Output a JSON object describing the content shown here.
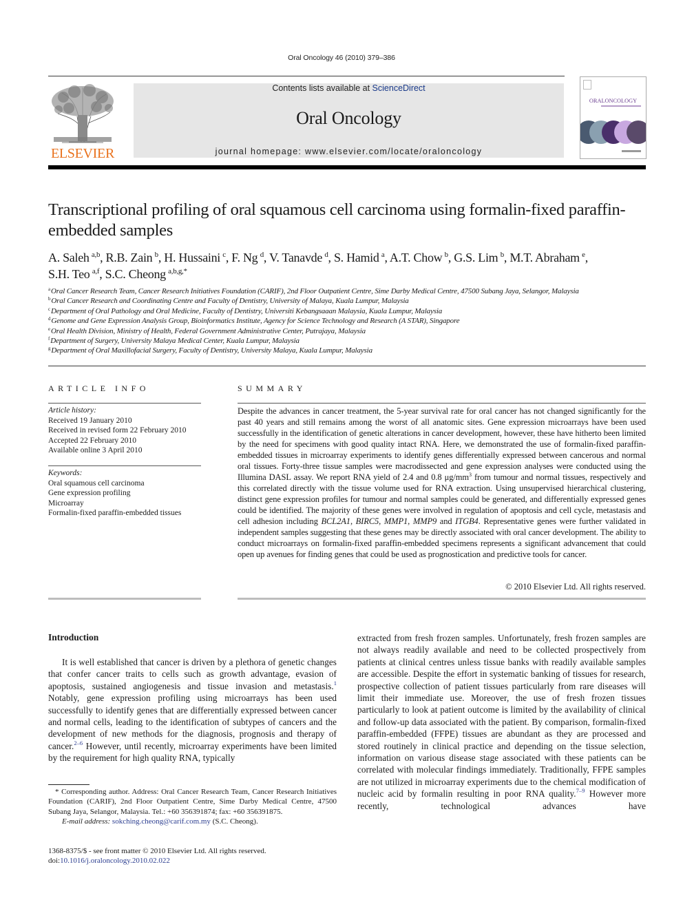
{
  "header": {
    "citation": "Oral Oncology 46 (2010) 379–386",
    "publisher_logo_text": "ELSEVIER",
    "contents_prefix": "Contents lists available at ",
    "contents_link": "ScienceDirect",
    "journal_title": "Oral Oncology",
    "homepage": "journal homepage: www.elsevier.com/locate/oraloncology",
    "cover_title": "ORALONCOLOGY"
  },
  "colors": {
    "publisher_orange": "#e9711c",
    "link_blue": "#2a3c8f",
    "masthead_gray": "#e6e6e6",
    "cover_purple": "#6a3d8f"
  },
  "article": {
    "title": "Transcriptional profiling of oral squamous cell carcinoma using formalin-fixed paraffin-embedded samples",
    "authors": [
      {
        "name": "A. Saleh",
        "sup": "a,b"
      },
      {
        "name": "R.B. Zain",
        "sup": "b"
      },
      {
        "name": "H. Hussaini",
        "sup": "c"
      },
      {
        "name": "F. Ng",
        "sup": "d"
      },
      {
        "name": "V. Tanavde",
        "sup": "d"
      },
      {
        "name": "S. Hamid",
        "sup": "a"
      },
      {
        "name": "A.T. Chow",
        "sup": "b"
      },
      {
        "name": "G.S. Lim",
        "sup": "b"
      },
      {
        "name": "M.T. Abraham",
        "sup": "e"
      },
      {
        "name": "S.H. Teo",
        "sup": "a,f"
      },
      {
        "name": "S.C. Cheong",
        "sup": "a,b,g,*"
      }
    ],
    "affiliations": [
      {
        "key": "a",
        "text": "Oral Cancer Research Team, Cancer Research Initiatives Foundation (CARIF), 2nd Floor Outpatient Centre, Sime Darby Medical Centre, 47500 Subang Jaya, Selangor, Malaysia"
      },
      {
        "key": "b",
        "text": "Oral Cancer Research and Coordinating Centre and Faculty of Dentistry, University of Malaya, Kuala Lumpur, Malaysia"
      },
      {
        "key": "c",
        "text": "Department of Oral Pathology and Oral Medicine, Faculty of Dentistry, Universiti Kebangsaaan Malaysia, Kuala Lumpur, Malaysia"
      },
      {
        "key": "d",
        "text": "Genome and Gene Expression Analysis Group, Bioinformatics Institute, Agency for Science Technology and Research (A STAR), Singapore"
      },
      {
        "key": "e",
        "text": "Oral Health Division, Ministry of Health, Federal Government Administrative Center, Putrajaya, Malaysia"
      },
      {
        "key": "f",
        "text": "Department of Surgery, University Malaya Medical Center, Kuala Lumpur, Malaysia"
      },
      {
        "key": "g",
        "text": "Department of Oral Maxillofacial Surgery, Faculty of Dentistry, University Malaya, Kuala Lumpur, Malaysia"
      }
    ]
  },
  "article_info": {
    "heading": "ARTICLE INFO",
    "history_label": "Article history:",
    "history": [
      "Received 19 January 2010",
      "Received in revised form 22 February 2010",
      "Accepted 22 February 2010",
      "Available online 3 April 2010"
    ],
    "keywords_label": "Keywords:",
    "keywords": [
      "Oral squamous cell carcinoma",
      "Gene expression profiling",
      "Microarray",
      "Formalin-fixed paraffin-embedded tissues"
    ]
  },
  "summary": {
    "heading": "SUMMARY",
    "part1": "Despite the advances in cancer treatment, the 5-year survival rate for oral cancer has not changed significantly for the past 40 years and still remains among the worst of all anatomic sites. Gene expression microarrays have been used successfully in the identification of genetic alterations in cancer development, however, these have hitherto been limited by the need for specimens with good quality intact RNA. Here, we demonstrated the use of formalin-fixed paraffin-embedded tissues in microarray experiments to identify genes differentially expressed between cancerous and normal oral tissues. Forty-three tissue samples were macrodissected and gene expression analyses were conducted using the Illumina DASL assay. We report RNA yield of 2.4 and 0.8 μg/mm",
    "sup1": "3",
    "part2": " from tumour and normal tissues, respectively and this correlated directly with the tissue volume used for RNA extraction. Using unsupervised hierarchical clustering, distinct gene expression profiles for tumour and normal samples could be generated, and differentially expressed genes could be identified. The majority of these genes were involved in regulation of apoptosis and cell cycle, metastasis and cell adhesion including ",
    "genes": [
      "BCL2A1",
      "BIRC5",
      "MMP1",
      "MMP9",
      "ITGB4"
    ],
    "sep1": ", ",
    "sep_and": " and ",
    "part3": ". Representative genes were further validated in independent samples suggesting that these genes may be directly associated with oral cancer development. The ability to conduct microarrays on formalin-fixed paraffin-embedded specimens represents a significant advancement that could open up avenues for finding genes that could be used as prognostication and predictive tools for cancer.",
    "copyright": "© 2010 Elsevier Ltd. All rights reserved."
  },
  "body": {
    "intro_heading": "Introduction",
    "left_p1_a": "It is well established that cancer is driven by a plethora of genetic changes that confer cancer traits to cells such as growth advantage, evasion of apoptosis, sustained angiogenesis and tissue invasion and metastasis.",
    "left_ref1": "1",
    "left_p1_b": " Notably, gene expression profiling using microarrays has been used successfully to identify genes that are differentially expressed between cancer and normal cells, leading to the identification of subtypes of cancers and the development of new methods for the diagnosis, prognosis and therapy of cancer.",
    "left_ref2": "2–6",
    "left_p1_c": " However, until recently, microarray experiments have been limited by the requirement for high quality RNA, typically",
    "right_a": "extracted from fresh frozen samples. Unfortunately, fresh frozen samples are not always readily available and need to be collected prospectively from patients at clinical centres unless tissue banks with readily available samples are accessible. Despite the effort in systematic banking of tissues for research, prospective collection of patient tissues particularly from rare diseases will limit their immediate use. Moreover, the use of fresh frozen tissues particularly to look at patient outcome is limited by the availability of clinical and follow-up data associated with the patient. By comparison, formalin-fixed paraffin-embedded (FFPE) tissues are abundant as they are processed and stored routinely in clinical practice and depending on the tissue selection, information on various disease stage associated with these patients can be correlated with molecular findings immediately. Traditionally, FFPE samples are not utilized in microarray experiments due to the chemical modification of nucleic acid by formalin resulting in poor RNA quality.",
    "right_ref": "7–9",
    "right_b": " However more recently, technological advances have"
  },
  "footnote": {
    "corresponding": "* Corresponding author. Address: Oral Cancer Research Team, Cancer Research Initiatives Foundation (CARIF), 2nd Floor Outpatient Centre, Sime Darby Medical Centre, 47500 Subang Jaya, Selangor, Malaysia. Tel.: +60 356391874; fax: +60 356391875.",
    "email_label": "E-mail address:",
    "email": "sokching.cheong@carif.com.my",
    "email_suffix": " (S.C. Cheong).",
    "front_matter": "1368-8375/$ - see front matter © 2010 Elsevier Ltd. All rights reserved.",
    "doi_prefix": "doi:",
    "doi": "10.1016/j.oraloncology.2010.02.022"
  }
}
